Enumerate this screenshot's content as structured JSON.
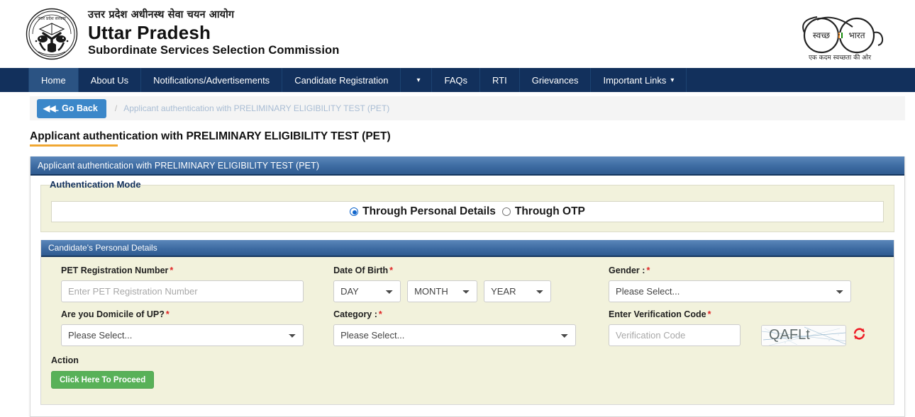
{
  "header": {
    "emblem_alt": "uttar-pradesh-state-emblem",
    "hindi_title": "उत्तर प्रदेश अधीनस्थ सेवा चयन आयोग",
    "english_title_line1": "Uttar Pradesh",
    "english_title_line2": "Subordinate Services Selection Commission",
    "swachh_logo": {
      "left_word": "स्वच्छ",
      "right_word": "भारत",
      "tagline": "एक कदम स्वच्छता की ओर"
    }
  },
  "nav": {
    "items": [
      {
        "label": "Home",
        "active": true,
        "caret": false
      },
      {
        "label": "About Us",
        "active": false,
        "caret": false
      },
      {
        "label": "Notifications/Advertisements",
        "active": false,
        "caret": false
      },
      {
        "label": "Candidate Registration",
        "active": false,
        "caret": false
      },
      {
        "label": "",
        "active": false,
        "caret": true
      },
      {
        "label": "FAQs",
        "active": false,
        "caret": false
      },
      {
        "label": "RTI",
        "active": false,
        "caret": false
      },
      {
        "label": "Grievances",
        "active": false,
        "caret": false
      },
      {
        "label": "Important Links",
        "active": false,
        "caret": true
      }
    ]
  },
  "breadcrumb": {
    "go_back_label": "Go Back",
    "go_back_prefix": "◀◀..",
    "separator": "/",
    "current": "Applicant authentication with PRELIMINARY ELIGIBILITY TEST (PET)"
  },
  "page": {
    "title": "Applicant authentication with PRELIMINARY ELIGIBILITY TEST (PET)",
    "panel_title": "Applicant authentication with PRELIMINARY ELIGIBILITY TEST (PET)"
  },
  "auth_mode": {
    "legend": "Authentication Mode",
    "options": [
      {
        "label": "Through Personal Details",
        "selected": true
      },
      {
        "label": "Through OTP",
        "selected": false
      }
    ]
  },
  "personal_details": {
    "section_title": "Candidate's Personal Details",
    "fields": {
      "pet_registration": {
        "label": "PET Registration Number",
        "required_marker": "*",
        "placeholder": "Enter PET Registration Number",
        "value": ""
      },
      "date_of_birth": {
        "label": "Date Of Birth",
        "required_marker": "*",
        "day": "DAY",
        "month": "MONTH",
        "year": "YEAR"
      },
      "gender": {
        "label": "Gender :",
        "required_marker": "*",
        "value": "Please Select..."
      },
      "domicile": {
        "label": "Are you Domicile of UP?",
        "required_marker": "*",
        "value": "Please Select..."
      },
      "category": {
        "label": "Category :",
        "required_marker": "*",
        "value": "Please Select..."
      },
      "verification_code": {
        "label": "Enter Verification Code",
        "required_marker": "*",
        "placeholder": "Verification Code",
        "value": "",
        "captcha_text": "QAFLt",
        "refresh_icon": "refresh-icon"
      }
    },
    "action": {
      "label": "Action",
      "button_label": "Click Here To Proceed"
    }
  },
  "colors": {
    "navbar": "#12305c",
    "nav_active": "#2b5383",
    "panel_header": "#3d6ba2",
    "form_background": "#f2f2dc",
    "go_back_button": "#3b87c9",
    "proceed_button": "#58b158",
    "required_asterisk": "#e02424",
    "title_underline": "#f0a732",
    "refresh_icon": "#ee1c25"
  }
}
